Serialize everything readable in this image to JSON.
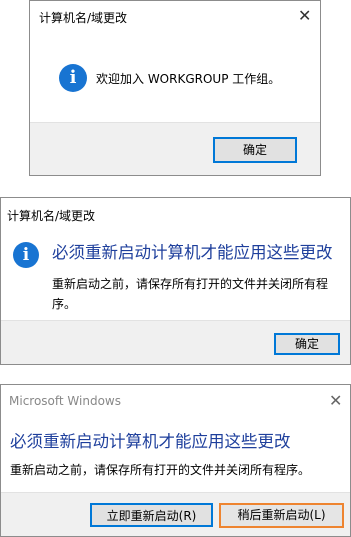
{
  "dialog1": {
    "title": "计算机名/域更改",
    "close_glyph": "✕",
    "message": "欢迎加入 WORKGROUP 工作组。",
    "ok_label": "确定"
  },
  "dialog2": {
    "title": "计算机名/域更改",
    "heading": "必须重新启动计算机才能应用这些更改",
    "body": "重新启动之前，请保存所有打开的文件并关闭所有程序。",
    "ok_label": "确定"
  },
  "dialog3": {
    "title": "Microsoft Windows",
    "close_glyph": "✕",
    "heading": "必须重新启动计算机才能应用这些更改",
    "body": "重新启动之前，请保存所有打开的文件并关闭所有程序。",
    "restart_now_label": "立即重新启动(R)",
    "restart_later_label": "稍后重新启动(L)"
  },
  "colors": {
    "info_icon": "#1874d2",
    "heading_text": "#1e3f9c",
    "focus_blue": "#0078d7",
    "focus_orange": "#ee8430",
    "footer_bg": "#f0f0f0"
  },
  "icons": {
    "info": "info-icon",
    "close": "close-icon"
  }
}
